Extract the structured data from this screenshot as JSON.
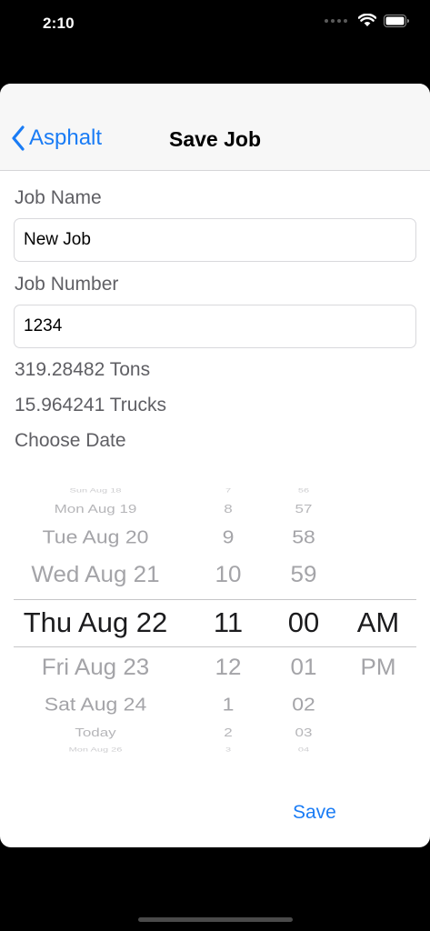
{
  "status": {
    "time": "2:10"
  },
  "nav": {
    "back_label": "Asphalt",
    "title": "Save Job"
  },
  "form": {
    "job_name_label": "Job Name",
    "job_name_value": "New Job",
    "job_number_label": "Job Number",
    "job_number_value": "1234",
    "tons": "319.28482 Tons",
    "trucks": "15.964241 Trucks",
    "choose_date_label": "Choose Date"
  },
  "picker": {
    "rows": [
      {
        "day": "Sun Aug 18",
        "hour": "7",
        "minute": "56",
        "ampm": ""
      },
      {
        "day": "Mon Aug 19",
        "hour": "8",
        "minute": "57",
        "ampm": ""
      },
      {
        "day": "Tue Aug 20",
        "hour": "9",
        "minute": "58",
        "ampm": ""
      },
      {
        "day": "Wed Aug 21",
        "hour": "10",
        "minute": "59",
        "ampm": ""
      },
      {
        "day": "Thu Aug 22",
        "hour": "11",
        "minute": "00",
        "ampm": "AM"
      },
      {
        "day": "Fri Aug 23",
        "hour": "12",
        "minute": "01",
        "ampm": "PM"
      },
      {
        "day": "Sat Aug 24",
        "hour": "1",
        "minute": "02",
        "ampm": ""
      },
      {
        "day": "Today",
        "hour": "2",
        "minute": "03",
        "ampm": ""
      },
      {
        "day": "Mon Aug 26",
        "hour": "3",
        "minute": "04",
        "ampm": ""
      }
    ]
  },
  "actions": {
    "save_label": "Save"
  },
  "colors": {
    "accent": "#1a7cf5",
    "secondary_text": "#5f5f64",
    "picker_faded": "#a4a4a8"
  },
  "icons": [
    "chevron-left-icon",
    "wifi-icon",
    "battery-icon",
    "cellular-signal-icon"
  ]
}
